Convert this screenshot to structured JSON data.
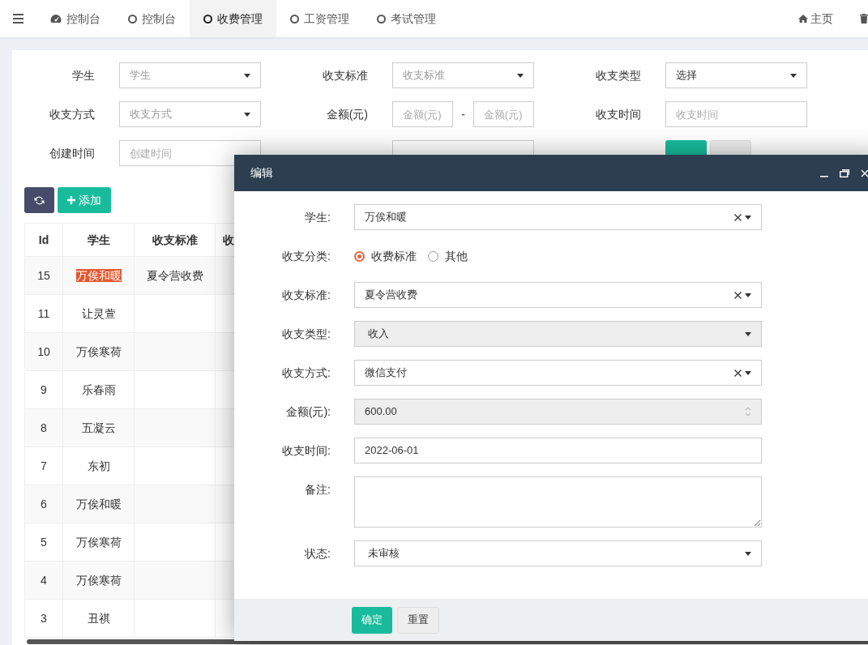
{
  "nav": {
    "tabs": [
      {
        "label": "控制台",
        "selected": false
      },
      {
        "label": "控制台",
        "selected": false
      },
      {
        "label": "收费管理",
        "selected": true
      },
      {
        "label": "工资管理",
        "selected": false
      },
      {
        "label": "考试管理",
        "selected": false
      }
    ],
    "home_link": "主页"
  },
  "filters": [
    {
      "label": "学生",
      "kind": "select",
      "placeholder": "学生"
    },
    {
      "label": "收支标准",
      "kind": "select",
      "placeholder": "收支标准"
    },
    {
      "label": "收支类型",
      "kind": "select",
      "value": "选择"
    },
    {
      "label": "收支方式",
      "kind": "select",
      "placeholder": "收支方式"
    },
    {
      "label": "金额(元)",
      "kind": "range",
      "placeholders": [
        "金额(元)",
        "金额(元)"
      ],
      "separator": "-"
    },
    {
      "label": "收支时间",
      "kind": "text",
      "placeholder": "收支时间"
    },
    {
      "label": "创建时间",
      "kind": "text",
      "placeholder": "创建时间"
    },
    {
      "kind": "text"
    }
  ],
  "filter_buttons": [
    {
      "kind": "submit"
    },
    {
      "kind": "reset"
    }
  ],
  "toolbar": {
    "add_button": "添加"
  },
  "table": {
    "columns": [
      "Id",
      "学生",
      "收支标准",
      "收"
    ],
    "rows": [
      {
        "id": "15",
        "student": "万俟和暖",
        "standard": "夏令营收费",
        "highlighted": true
      },
      {
        "id": "11",
        "student": "让灵萱",
        "highlighted": false
      },
      {
        "id": "10",
        "student": "万俟寒荷",
        "highlighted": false
      },
      {
        "id": "9",
        "student": "乐春雨",
        "highlighted": false
      },
      {
        "id": "8",
        "student": "五凝云",
        "highlighted": false
      },
      {
        "id": "7",
        "student": "东初",
        "highlighted": false
      },
      {
        "id": "6",
        "student": "万俟和暖",
        "highlighted": false
      },
      {
        "id": "5",
        "student": "万俟寒荷",
        "highlighted": false
      },
      {
        "id": "4",
        "student": "万俟寒荷",
        "highlighted": false
      },
      {
        "id": "3",
        "student": "丑祺",
        "highlighted": false
      }
    ]
  },
  "modal": {
    "title": "编辑",
    "fields": [
      {
        "label": "学生:",
        "kind": "select",
        "value": "万俟和暖",
        "clearable": true,
        "disabled": false
      },
      {
        "label": "收支分类:",
        "kind": "radio",
        "options": [
          {
            "label": "收费标准",
            "selected": true
          },
          {
            "label": "其他",
            "selected": false
          }
        ]
      },
      {
        "label": "收支标准:",
        "kind": "select",
        "value": "夏令营收费",
        "clearable": true,
        "disabled": false
      },
      {
        "label": "收支类型:",
        "kind": "select",
        "value": "收入",
        "clearable": false,
        "disabled": true
      },
      {
        "label": "收支方式:",
        "kind": "select",
        "value": "微信支付",
        "clearable": true,
        "disabled": false
      },
      {
        "label": "金额(元):",
        "kind": "number",
        "value": "600.00",
        "disabled": true
      },
      {
        "label": "收支时间:",
        "kind": "text",
        "value": "2022-06-01",
        "disabled": false
      },
      {
        "label": "备注:",
        "kind": "textarea"
      },
      {
        "label": "状态:",
        "kind": "select",
        "value": "未审核",
        "clearable": false,
        "disabled": false
      }
    ],
    "buttons": [
      "确定",
      "重置"
    ]
  }
}
